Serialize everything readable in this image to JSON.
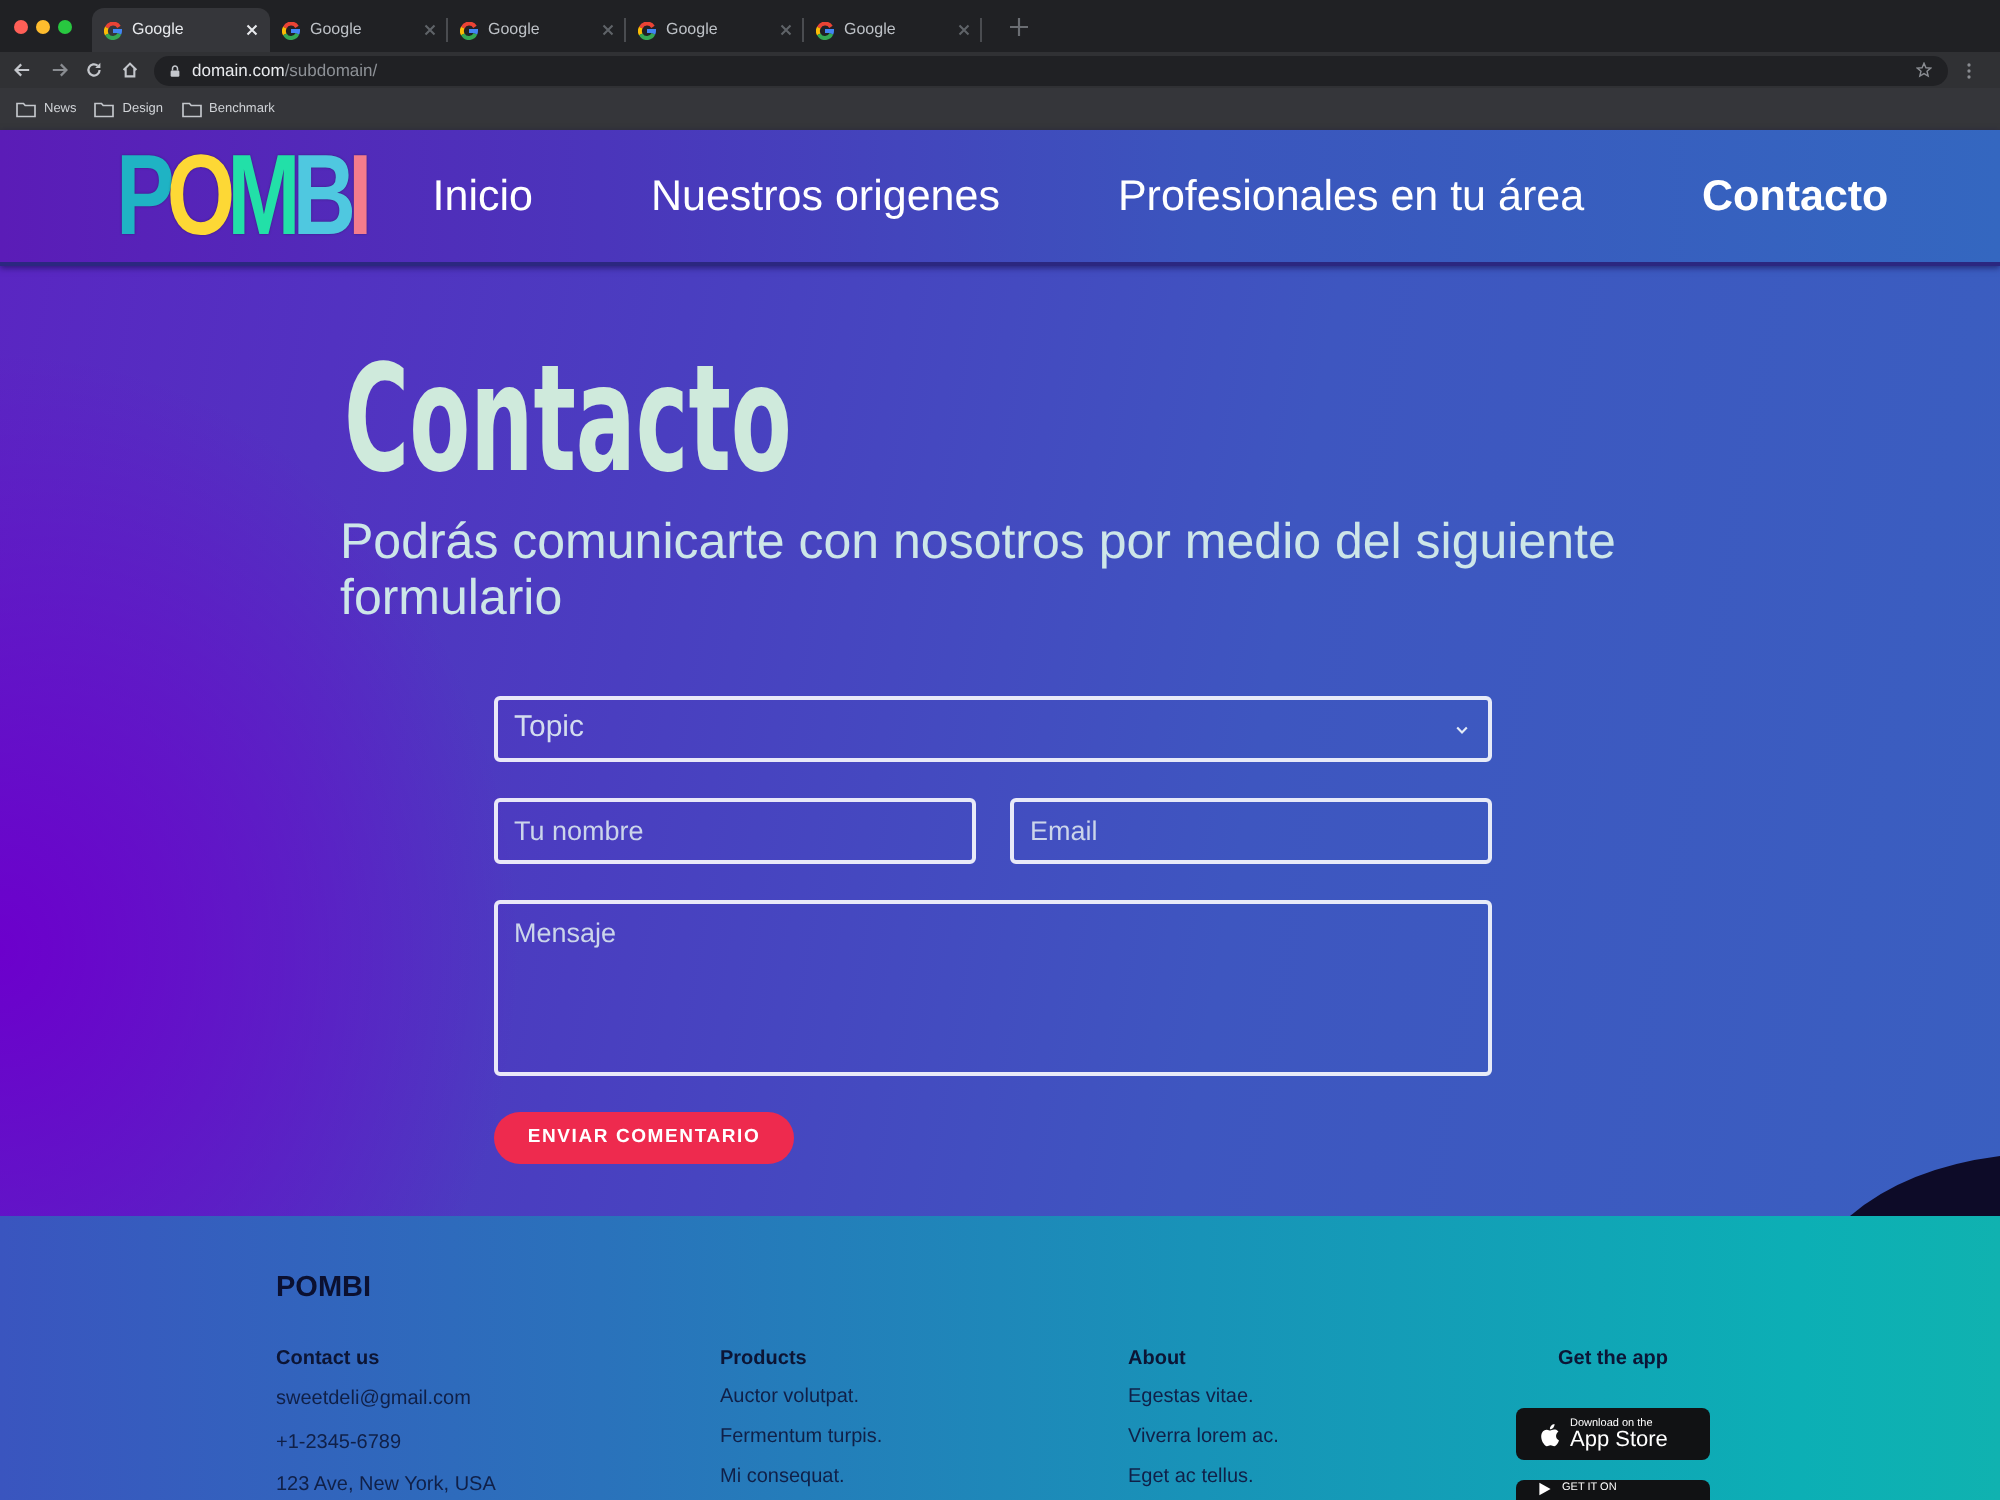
{
  "browser": {
    "tabs": [
      {
        "title": "Google",
        "selected": true
      },
      {
        "title": "Google",
        "selected": false
      },
      {
        "title": "Google",
        "selected": false
      },
      {
        "title": "Google",
        "selected": false
      },
      {
        "title": "Google",
        "selected": false
      }
    ],
    "url": {
      "host": "domain.com",
      "path": "/subdomain/"
    },
    "bookmarks": [
      "News",
      "Design",
      "Benchmark"
    ]
  },
  "navbar": {
    "logo": "POMBI",
    "items": [
      {
        "label": "Inicio",
        "selected": false
      },
      {
        "label": "Nuestros origenes",
        "selected": false
      },
      {
        "label": "Profesionales en tu área",
        "selected": false
      },
      {
        "label": "Contacto",
        "selected": true
      }
    ]
  },
  "hero": {
    "title": "Contacto",
    "subtitle": "Podrás comunicarte con nosotros por medio del siguiente formulario"
  },
  "form": {
    "topic_select": {
      "value": "Topic"
    },
    "name_field": {
      "placeholder": "Tu nombre"
    },
    "email_field": {
      "placeholder": "Email"
    },
    "message_field": {
      "placeholder": "Mensaje"
    },
    "submit_button": "ENVIAR COMENTARIO"
  },
  "footer": {
    "brand": "POMBI",
    "columns": [
      {
        "heading": "Contact us",
        "items": [
          "sweetdeli@gmail.com",
          "+1-2345-6789",
          "123 Ave, New York, USA"
        ]
      },
      {
        "heading": "Products",
        "items": [
          "Auctor volutpat.",
          "Fermentum turpis.",
          "Mi consequat."
        ]
      },
      {
        "heading": "About",
        "items": [
          "Egestas vitae.",
          "Viverra lorem ac.",
          "Eget ac tellus."
        ]
      }
    ],
    "app": {
      "heading": "Get the app",
      "badges": [
        {
          "kind": "apple",
          "caption": "Download on the",
          "title": "App Store"
        },
        {
          "kind": "google",
          "caption": "GET IT ON"
        }
      ]
    }
  }
}
